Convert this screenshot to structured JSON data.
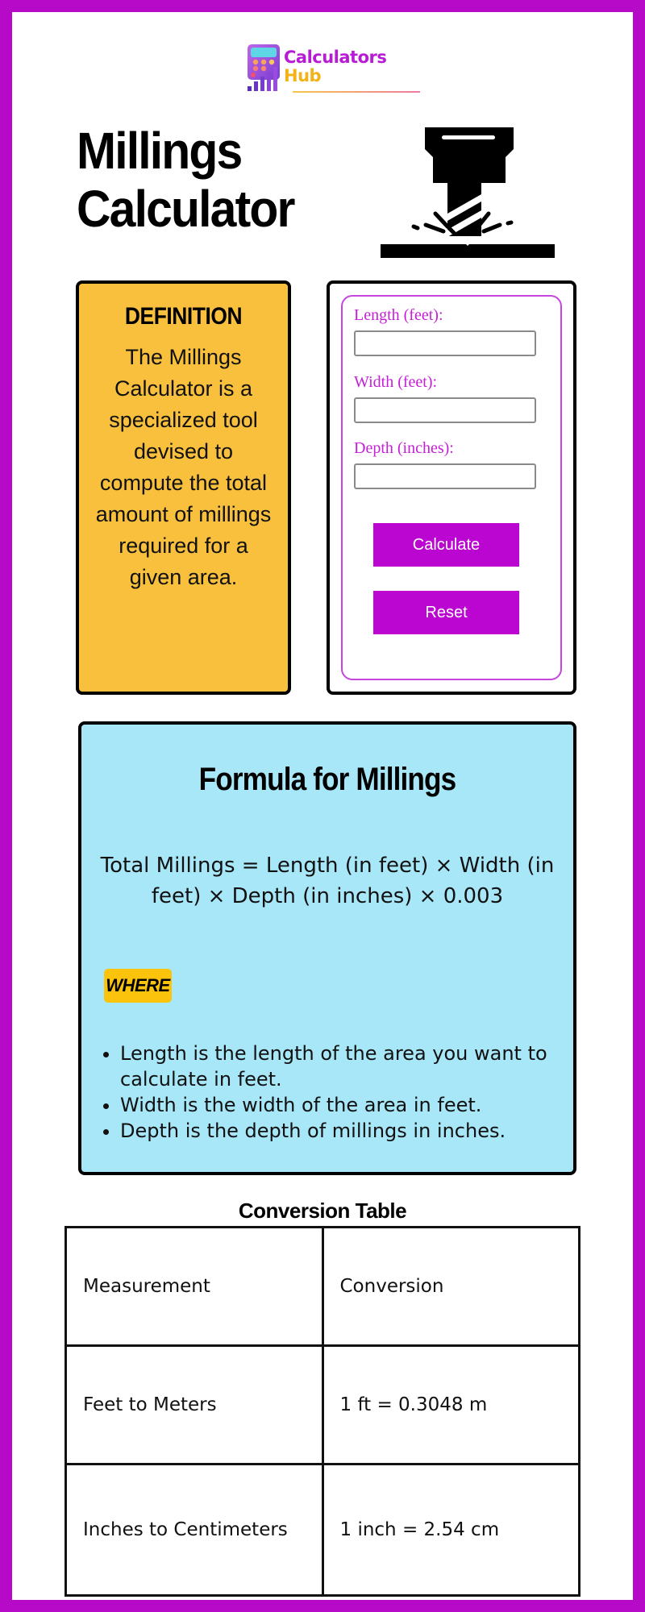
{
  "colors": {
    "frame": "#b70ac8",
    "accent": "#bb06d1",
    "definition_bg": "#f8c03d",
    "formula_bg": "#a8e7f8",
    "where_badge_bg": "#fbc30c",
    "field_label": "#c41fd6"
  },
  "logo": {
    "line1": "Calculators",
    "line2": "Hub",
    "icon": "calculator-bar-chart-icon"
  },
  "header": {
    "title_line1": "Millings",
    "title_line2": "Calculator",
    "illustration": "milling-machine-icon"
  },
  "definition": {
    "heading": "DEFINITION",
    "body": "The Millings Calculator is a specialized tool devised to compute the total amount of millings required for a given area."
  },
  "calculator": {
    "fields": [
      {
        "label": "Length (feet):",
        "value": "",
        "placeholder": ""
      },
      {
        "label": "Width (feet):",
        "value": "",
        "placeholder": ""
      },
      {
        "label": "Depth (inches):",
        "value": "",
        "placeholder": ""
      }
    ],
    "calculate_label": "Calculate",
    "reset_label": "Reset"
  },
  "formula": {
    "heading": "Formula for Millings",
    "expression": "Total Millings = Length (in feet) × Width (in feet) × Depth (in inches) × 0.003",
    "where_label": "WHERE",
    "items": [
      "Length is the length of the area you want to calculate in feet.",
      "Width is the width of the area in feet.",
      "Depth is the depth of millings in inches."
    ]
  },
  "conversion_table": {
    "title": "Conversion Table",
    "rows": [
      [
        "Measurement",
        "Conversion"
      ],
      [
        "Feet to Meters",
        "1 ft = 0.3048 m"
      ],
      [
        "Inches to Centimeters",
        "1 inch = 2.54 cm"
      ]
    ]
  }
}
